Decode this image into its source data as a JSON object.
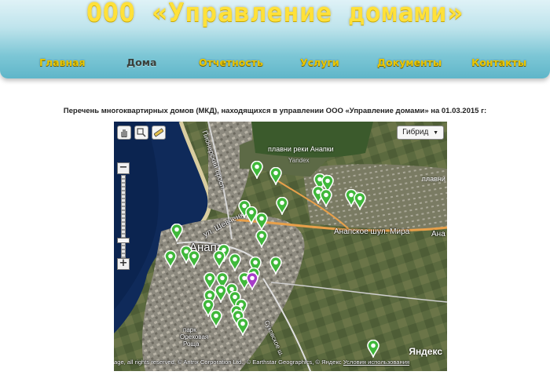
{
  "site": {
    "title": "ООО «Управление домами»"
  },
  "nav": {
    "items": [
      {
        "label": "Главная"
      },
      {
        "label": "Дома"
      },
      {
        "label": "Отчетность"
      },
      {
        "label": "Услуги"
      },
      {
        "label": "Документы"
      },
      {
        "label": "Контакты"
      }
    ],
    "active": "Дома"
  },
  "content": {
    "caption": "Перечень многоквартирных домов (МКД), находящихся в управлении ООО «Управление домами» на 01.03.2015 г:"
  },
  "map": {
    "layer_label": "Гибрид",
    "zoom_in_label": "+",
    "zoom_out_label": "−",
    "zoom_level_fraction": 0.2,
    "tools": [
      "hand-icon",
      "magnifier-icon",
      "ruler-icon"
    ],
    "labels": {
      "avenue": "Пионерский просп.",
      "river": "плавни реки Анапки",
      "yandex_small": "Yandex",
      "marsh_right": "плавни",
      "city": "Анапа",
      "shevchenko": "ул. Шевченко",
      "anapa_highway": "Анапское ш.",
      "mira": "ул. Мира",
      "ana": "Ана",
      "sukovskoe": "Суковское ш.",
      "grove_1": "парк",
      "grove_2": "Ореховая",
      "grove_3": "Роща"
    },
    "markers": {
      "green_count": 37,
      "purple_count": 1,
      "colors": {
        "green": "#3fb83a",
        "purple": "#a63cc8"
      }
    },
    "copyright": "age, all rights reserved, © Antrix Corporation Ltd., © Earthstar Geographics, © Яндекс",
    "terms_label": "Условия использования",
    "logo": "Яндекс"
  },
  "colors": {
    "title": "#ffe13a",
    "nav": "#e9c600",
    "nav_active": "#3a3f3a",
    "header_top": "#dff2f7",
    "header_bottom": "#5fb6c9"
  }
}
